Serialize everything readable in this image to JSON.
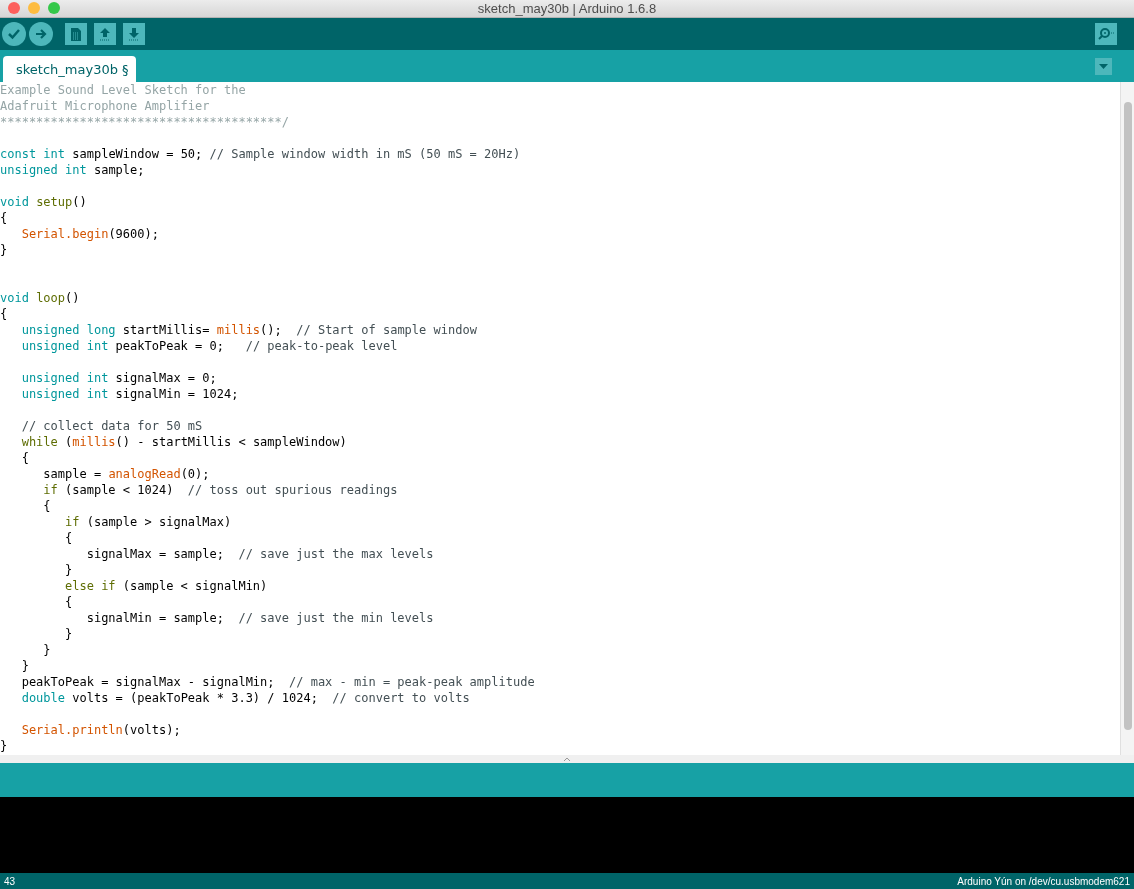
{
  "window": {
    "title": "sketch_may30b | Arduino 1.6.8"
  },
  "toolbar": {
    "buttons": [
      {
        "kind": "verify"
      },
      {
        "kind": "upload"
      },
      {
        "kind": "new"
      },
      {
        "kind": "open"
      },
      {
        "kind": "save"
      }
    ],
    "right_button": {
      "kind": "serial_monitor"
    }
  },
  "tabs": [
    {
      "label": "sketch_may30b §",
      "selected": true
    }
  ],
  "editor": {
    "lines": [
      {
        "kind": "code",
        "tokens": [
          {
            "kind": "block",
            "t": "Example Sound Level Sketch for the"
          }
        ]
      },
      {
        "kind": "code",
        "tokens": [
          {
            "kind": "block",
            "t": "Adafruit Microphone Amplifier"
          }
        ]
      },
      {
        "kind": "code",
        "tokens": [
          {
            "kind": "block",
            "t": "***************************************/"
          }
        ]
      },
      {
        "kind": "blank"
      },
      {
        "kind": "code",
        "tokens": [
          {
            "kind": "type",
            "t": "const int"
          },
          {
            "kind": "plain",
            "t": " sampleWindow = 50; "
          },
          {
            "kind": "comment",
            "t": "// Sample window width in mS (50 mS = 20Hz)"
          }
        ]
      },
      {
        "kind": "code",
        "tokens": [
          {
            "kind": "type",
            "t": "unsigned int"
          },
          {
            "kind": "plain",
            "t": " sample;"
          }
        ]
      },
      {
        "kind": "blank"
      },
      {
        "kind": "code",
        "tokens": [
          {
            "kind": "type",
            "t": "void"
          },
          {
            "kind": "func",
            "t": " setup"
          },
          {
            "kind": "plain",
            "t": "()"
          }
        ]
      },
      {
        "kind": "code",
        "tokens": [
          {
            "kind": "plain",
            "t": "{"
          }
        ]
      },
      {
        "kind": "code",
        "tokens": [
          {
            "kind": "builtin",
            "t": "   Serial.begin"
          },
          {
            "kind": "plain",
            "t": "(9600);"
          }
        ]
      },
      {
        "kind": "code",
        "tokens": [
          {
            "kind": "plain",
            "t": "}"
          }
        ]
      },
      {
        "kind": "blank"
      },
      {
        "kind": "blank"
      },
      {
        "kind": "code",
        "tokens": [
          {
            "kind": "type",
            "t": "void"
          },
          {
            "kind": "func",
            "t": " loop"
          },
          {
            "kind": "plain",
            "t": "()"
          }
        ]
      },
      {
        "kind": "code",
        "tokens": [
          {
            "kind": "plain",
            "t": "{"
          }
        ]
      },
      {
        "kind": "code",
        "tokens": [
          {
            "kind": "type",
            "t": "   unsigned long"
          },
          {
            "kind": "plain",
            "t": " startMillis= "
          },
          {
            "kind": "builtin",
            "t": "millis"
          },
          {
            "kind": "plain",
            "t": "();  "
          },
          {
            "kind": "comment",
            "t": "// Start of sample window"
          }
        ]
      },
      {
        "kind": "code",
        "tokens": [
          {
            "kind": "type",
            "t": "   unsigned int"
          },
          {
            "kind": "plain",
            "t": " peakToPeak = 0;   "
          },
          {
            "kind": "comment",
            "t": "// peak-to-peak level"
          }
        ]
      },
      {
        "kind": "blank"
      },
      {
        "kind": "code",
        "tokens": [
          {
            "kind": "type",
            "t": "   unsigned int"
          },
          {
            "kind": "plain",
            "t": " signalMax = 0;"
          }
        ]
      },
      {
        "kind": "code",
        "tokens": [
          {
            "kind": "type",
            "t": "   unsigned int"
          },
          {
            "kind": "plain",
            "t": " signalMin = 1024;"
          }
        ]
      },
      {
        "kind": "blank"
      },
      {
        "kind": "code",
        "tokens": [
          {
            "kind": "comment",
            "t": "   // collect data for 50 mS"
          }
        ]
      },
      {
        "kind": "code",
        "tokens": [
          {
            "kind": "func",
            "t": "   while"
          },
          {
            "kind": "plain",
            "t": " ("
          },
          {
            "kind": "builtin",
            "t": "millis"
          },
          {
            "kind": "plain",
            "t": "() - startMillis < sampleWindow)"
          }
        ]
      },
      {
        "kind": "code",
        "tokens": [
          {
            "kind": "plain",
            "t": "   {"
          }
        ]
      },
      {
        "kind": "code",
        "tokens": [
          {
            "kind": "plain",
            "t": "      sample = "
          },
          {
            "kind": "builtin",
            "t": "analogRead"
          },
          {
            "kind": "plain",
            "t": "(0);"
          }
        ]
      },
      {
        "kind": "code",
        "tokens": [
          {
            "kind": "func",
            "t": "      if"
          },
          {
            "kind": "plain",
            "t": " (sample < 1024)  "
          },
          {
            "kind": "comment",
            "t": "// toss out spurious readings"
          }
        ]
      },
      {
        "kind": "code",
        "tokens": [
          {
            "kind": "plain",
            "t": "      {"
          }
        ]
      },
      {
        "kind": "code",
        "tokens": [
          {
            "kind": "func",
            "t": "         if"
          },
          {
            "kind": "plain",
            "t": " (sample > signalMax)"
          }
        ]
      },
      {
        "kind": "code",
        "tokens": [
          {
            "kind": "plain",
            "t": "         {"
          }
        ]
      },
      {
        "kind": "code",
        "tokens": [
          {
            "kind": "plain",
            "t": "            signalMax = sample;  "
          },
          {
            "kind": "comment",
            "t": "// save just the max levels"
          }
        ]
      },
      {
        "kind": "code",
        "tokens": [
          {
            "kind": "plain",
            "t": "         }"
          }
        ]
      },
      {
        "kind": "code",
        "tokens": [
          {
            "kind": "func",
            "t": "         else if"
          },
          {
            "kind": "plain",
            "t": " (sample < signalMin)"
          }
        ]
      },
      {
        "kind": "code",
        "tokens": [
          {
            "kind": "plain",
            "t": "         {"
          }
        ]
      },
      {
        "kind": "code",
        "tokens": [
          {
            "kind": "plain",
            "t": "            signalMin = sample;  "
          },
          {
            "kind": "comment",
            "t": "// save just the min levels"
          }
        ]
      },
      {
        "kind": "code",
        "tokens": [
          {
            "kind": "plain",
            "t": "         }"
          }
        ]
      },
      {
        "kind": "code",
        "tokens": [
          {
            "kind": "plain",
            "t": "      }"
          }
        ]
      },
      {
        "kind": "code",
        "tokens": [
          {
            "kind": "plain",
            "t": "   }"
          }
        ]
      },
      {
        "kind": "code",
        "tokens": [
          {
            "kind": "plain",
            "t": "   peakToPeak = signalMax - signalMin;  "
          },
          {
            "kind": "comment",
            "t": "// max - min = peak-peak amplitude"
          }
        ]
      },
      {
        "kind": "code",
        "tokens": [
          {
            "kind": "type",
            "t": "   double"
          },
          {
            "kind": "plain",
            "t": " volts = (peakToPeak * 3.3) / 1024;  "
          },
          {
            "kind": "comment",
            "t": "// convert to volts"
          }
        ]
      },
      {
        "kind": "blank"
      },
      {
        "kind": "code",
        "tokens": [
          {
            "kind": "builtin",
            "t": "   Serial.println"
          },
          {
            "kind": "plain",
            "t": "(volts);"
          }
        ]
      },
      {
        "kind": "code",
        "tokens": [
          {
            "kind": "plain",
            "t": "}"
          }
        ]
      }
    ]
  },
  "status_bar": {
    "line": "43",
    "board": "Arduino Yún on /dev/cu.usbmodem621"
  }
}
